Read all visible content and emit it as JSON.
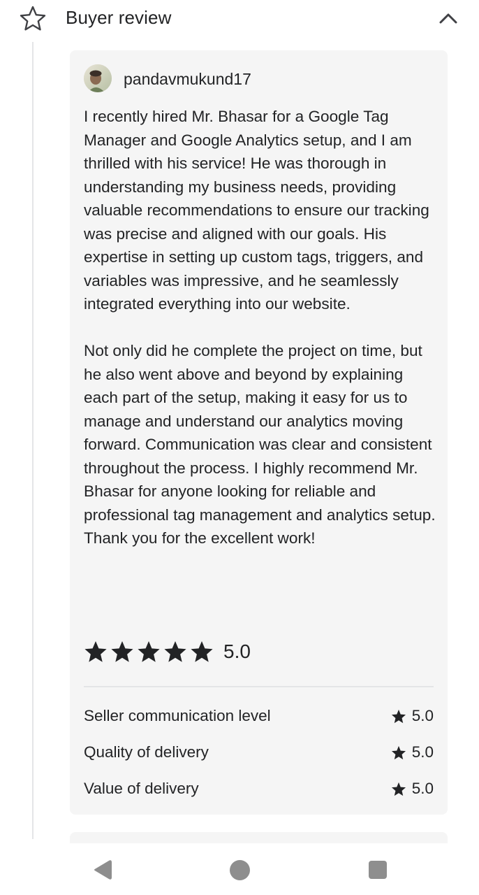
{
  "header": {
    "title": "Buyer review"
  },
  "review": {
    "username": "pandavmukund17",
    "paragraphs": [
      "I recently hired Mr. Bhasar for a Google Tag Manager and Google Analytics setup, and I am thrilled with his service! He was thorough in understanding my business needs, providing valuable recommendations to ensure our tracking was precise and aligned with our goals. His expertise in setting up custom tags, triggers, and variables was impressive, and he seamlessly integrated everything into our website.",
      "Not only did he complete the project on time, but he also went above and beyond by explaining each part of the setup, making it easy for us to manage and understand our analytics moving forward. Communication was clear and consistent throughout the process. I highly recommend Mr. Bhasar for anyone looking for reliable and professional tag management and analytics setup. Thank you for the excellent work!"
    ],
    "overall_stars": 5,
    "overall_score": "5.0",
    "breakdown": [
      {
        "label": "Seller communication level",
        "value": "5.0"
      },
      {
        "label": "Quality of delivery",
        "value": "5.0"
      },
      {
        "label": "Value of delivery",
        "value": "5.0"
      }
    ]
  },
  "icons": {
    "header_star": "star-outline-icon",
    "collapse": "chevron-up-icon",
    "rating_star": "star-filled-icon",
    "nav_back": "triangle-back-icon",
    "nav_home": "circle-home-icon",
    "nav_recent": "square-recents-icon"
  },
  "colors": {
    "text": "#222325",
    "card_background": "#f5f5f5",
    "divider": "#e4e5e7",
    "nav_icons": "#8e8e8e"
  }
}
